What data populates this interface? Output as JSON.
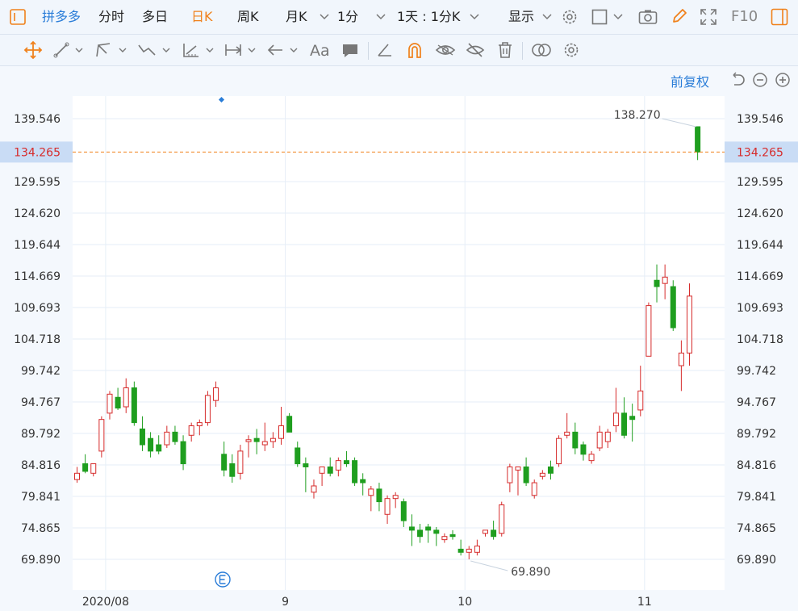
{
  "toolbar": {
    "brand": "拼多多",
    "tabs": [
      "分时",
      "多日",
      "日K",
      "周K",
      "月K",
      "1分",
      "1天 : 1分K",
      "显示"
    ],
    "active_tab": "日K",
    "f10_label": "F10"
  },
  "price_restore_label": "前复权",
  "icons": {
    "row1": [
      "panel-toggle-icon",
      "settings-icon",
      "square-icon",
      "camera-icon",
      "pencil-icon",
      "fullscreen-icon",
      "sidebar-icon"
    ],
    "row2": [
      "crosshair-move-icon",
      "line-tool-icon",
      "pen-tool-icon",
      "trend-tool-icon",
      "measure-tool-icon",
      "range-tool-icon",
      "arrow-tool-icon",
      "text-tool-icon",
      "comment-tool-icon",
      "angle-tool-icon",
      "magnet-icon",
      "eye-icon",
      "hide-icon",
      "trash-icon",
      "compare-icon",
      "settings-icon"
    ]
  },
  "colors": {
    "up": "#d62b2b",
    "down": "#1f9e1f",
    "accent": "#f0811b",
    "brand": "#2a7dd8"
  },
  "chart_data": {
    "type": "candlestick",
    "y_ticks": [
      "139.546",
      "129.595",
      "124.620",
      "119.644",
      "114.669",
      "109.693",
      "104.718",
      "99.742",
      "94.767",
      "89.792",
      "84.816",
      "79.841",
      "74.865",
      "69.890"
    ],
    "current_price": "134.265",
    "x_labels": [
      {
        "label": "2020/08",
        "index": 3.5
      },
      {
        "label": "9",
        "index": 25.5
      },
      {
        "label": "10",
        "index": 47.5
      },
      {
        "label": "11",
        "index": 69.5
      }
    ],
    "annotations": [
      {
        "text": "138.270",
        "index": 76
      },
      {
        "text": "69.890",
        "index": 48
      }
    ],
    "ylim": [
      67.5,
      142
    ],
    "candles": [
      {
        "o": 82.5,
        "h": 84.5,
        "l": 82.0,
        "c": 83.5
      },
      {
        "o": 85.0,
        "h": 86.5,
        "l": 83.5,
        "c": 83.8
      },
      {
        "o": 83.5,
        "h": 85.0,
        "l": 83.0,
        "c": 85.0
      },
      {
        "o": 87.0,
        "h": 92.5,
        "l": 86.0,
        "c": 92.0
      },
      {
        "o": 93.0,
        "h": 96.5,
        "l": 92.0,
        "c": 96.0
      },
      {
        "o": 95.5,
        "h": 97.0,
        "l": 93.5,
        "c": 93.8
      },
      {
        "o": 94.0,
        "h": 98.5,
        "l": 93.0,
        "c": 97.0
      },
      {
        "o": 97.0,
        "h": 98.0,
        "l": 91.0,
        "c": 91.5
      },
      {
        "o": 90.5,
        "h": 92.5,
        "l": 87.0,
        "c": 88.0
      },
      {
        "o": 89.0,
        "h": 90.0,
        "l": 86.0,
        "c": 87.0
      },
      {
        "o": 88.0,
        "h": 89.5,
        "l": 86.5,
        "c": 87.0
      },
      {
        "o": 88.0,
        "h": 91.0,
        "l": 87.5,
        "c": 90.0
      },
      {
        "o": 90.0,
        "h": 91.0,
        "l": 88.0,
        "c": 88.5
      },
      {
        "o": 88.5,
        "h": 89.5,
        "l": 84.0,
        "c": 85.0
      },
      {
        "o": 89.5,
        "h": 91.5,
        "l": 88.5,
        "c": 91.0
      },
      {
        "o": 91.0,
        "h": 92.0,
        "l": 89.5,
        "c": 91.5
      },
      {
        "o": 91.5,
        "h": 96.5,
        "l": 91.0,
        "c": 95.8
      },
      {
        "o": 95.0,
        "h": 98.0,
        "l": 94.0,
        "c": 97.0
      },
      {
        "o": 86.5,
        "h": 88.5,
        "l": 83.0,
        "c": 84.0
      },
      {
        "o": 85.0,
        "h": 86.5,
        "l": 82.0,
        "c": 83.0
      },
      {
        "o": 83.5,
        "h": 88.0,
        "l": 82.5,
        "c": 87.0
      },
      {
        "o": 88.5,
        "h": 89.5,
        "l": 86.0,
        "c": 88.8
      },
      {
        "o": 89.0,
        "h": 90.5,
        "l": 86.5,
        "c": 88.5
      },
      {
        "o": 88.0,
        "h": 91.5,
        "l": 87.0,
        "c": 88.5
      },
      {
        "o": 88.5,
        "h": 90.0,
        "l": 87.5,
        "c": 89.0
      },
      {
        "o": 89.0,
        "h": 94.0,
        "l": 88.0,
        "c": 91.0
      },
      {
        "o": 92.5,
        "h": 93.0,
        "l": 90.0,
        "c": 90.0
      },
      {
        "o": 87.5,
        "h": 88.5,
        "l": 84.5,
        "c": 85.0
      },
      {
        "o": 85.0,
        "h": 86.0,
        "l": 80.5,
        "c": 84.5
      },
      {
        "o": 80.5,
        "h": 82.5,
        "l": 79.5,
        "c": 81.5
      },
      {
        "o": 83.5,
        "h": 84.5,
        "l": 81.5,
        "c": 84.5
      },
      {
        "o": 84.5,
        "h": 86.0,
        "l": 83.0,
        "c": 83.5
      },
      {
        "o": 84.0,
        "h": 86.0,
        "l": 83.0,
        "c": 85.5
      },
      {
        "o": 85.5,
        "h": 87.0,
        "l": 84.5,
        "c": 85.0
      },
      {
        "o": 85.5,
        "h": 86.0,
        "l": 81.5,
        "c": 82.0
      },
      {
        "o": 82.5,
        "h": 83.5,
        "l": 80.0,
        "c": 82.0
      },
      {
        "o": 80.0,
        "h": 81.5,
        "l": 77.5,
        "c": 81.0
      },
      {
        "o": 81.0,
        "h": 82.0,
        "l": 77.5,
        "c": 79.0
      },
      {
        "o": 77.0,
        "h": 80.0,
        "l": 75.5,
        "c": 79.5
      },
      {
        "o": 79.5,
        "h": 80.5,
        "l": 78.0,
        "c": 80.0
      },
      {
        "o": 79.0,
        "h": 79.5,
        "l": 75.0,
        "c": 76.0
      },
      {
        "o": 75.0,
        "h": 77.0,
        "l": 72.0,
        "c": 74.5
      },
      {
        "o": 74.5,
        "h": 75.5,
        "l": 72.5,
        "c": 73.5
      },
      {
        "o": 75.0,
        "h": 75.5,
        "l": 72.5,
        "c": 74.5
      },
      {
        "o": 74.5,
        "h": 75.0,
        "l": 72.0,
        "c": 74.0
      },
      {
        "o": 73.0,
        "h": 74.0,
        "l": 72.5,
        "c": 73.5
      },
      {
        "o": 73.8,
        "h": 74.5,
        "l": 73.0,
        "c": 73.5
      },
      {
        "o": 71.5,
        "h": 73.0,
        "l": 70.5,
        "c": 71.0
      },
      {
        "o": 71.0,
        "h": 72.0,
        "l": 69.89,
        "c": 71.5
      },
      {
        "o": 71.0,
        "h": 73.0,
        "l": 70.5,
        "c": 72.0
      },
      {
        "o": 74.0,
        "h": 74.5,
        "l": 73.5,
        "c": 74.5
      },
      {
        "o": 74.5,
        "h": 76.0,
        "l": 73.0,
        "c": 73.5
      },
      {
        "o": 74.0,
        "h": 79.0,
        "l": 73.5,
        "c": 78.5
      },
      {
        "o": 82.0,
        "h": 85.0,
        "l": 80.5,
        "c": 84.5
      },
      {
        "o": 84.0,
        "h": 84.5,
        "l": 80.0,
        "c": 84.5
      },
      {
        "o": 84.5,
        "h": 86.0,
        "l": 81.5,
        "c": 82.0
      },
      {
        "o": 80.0,
        "h": 82.5,
        "l": 79.5,
        "c": 82.0
      },
      {
        "o": 83.0,
        "h": 84.0,
        "l": 82.5,
        "c": 83.5
      },
      {
        "o": 84.5,
        "h": 85.5,
        "l": 82.5,
        "c": 83.5
      },
      {
        "o": 85.0,
        "h": 89.5,
        "l": 84.5,
        "c": 89.0
      },
      {
        "o": 89.5,
        "h": 93.0,
        "l": 89.0,
        "c": 90.0
      },
      {
        "o": 90.0,
        "h": 91.5,
        "l": 86.5,
        "c": 87.5
      },
      {
        "o": 88.0,
        "h": 88.5,
        "l": 85.5,
        "c": 86.5
      },
      {
        "o": 85.5,
        "h": 87.0,
        "l": 85.0,
        "c": 86.5
      },
      {
        "o": 87.5,
        "h": 91.0,
        "l": 87.0,
        "c": 90.0
      },
      {
        "o": 88.5,
        "h": 90.5,
        "l": 87.5,
        "c": 90.0
      },
      {
        "o": 91.0,
        "h": 97.0,
        "l": 90.0,
        "c": 93.0
      },
      {
        "o": 93.0,
        "h": 95.5,
        "l": 89.0,
        "c": 89.5
      },
      {
        "o": 92.5,
        "h": 94.5,
        "l": 88.5,
        "c": 92.0
      },
      {
        "o": 93.5,
        "h": 100.5,
        "l": 92.5,
        "c": 96.5
      },
      {
        "o": 102.0,
        "h": 110.5,
        "l": 102.0,
        "c": 110.0
      },
      {
        "o": 114.0,
        "h": 116.5,
        "l": 110.5,
        "c": 113.0
      },
      {
        "o": 113.5,
        "h": 116.5,
        "l": 111.0,
        "c": 114.5
      },
      {
        "o": 113.0,
        "h": 114.0,
        "l": 106.0,
        "c": 106.5
      },
      {
        "o": 100.5,
        "h": 104.5,
        "l": 96.5,
        "c": 102.5
      },
      {
        "o": 102.5,
        "h": 113.5,
        "l": 100.5,
        "c": 111.5
      },
      {
        "o": 138.27,
        "h": 138.27,
        "l": 133.0,
        "c": 134.265
      }
    ]
  }
}
